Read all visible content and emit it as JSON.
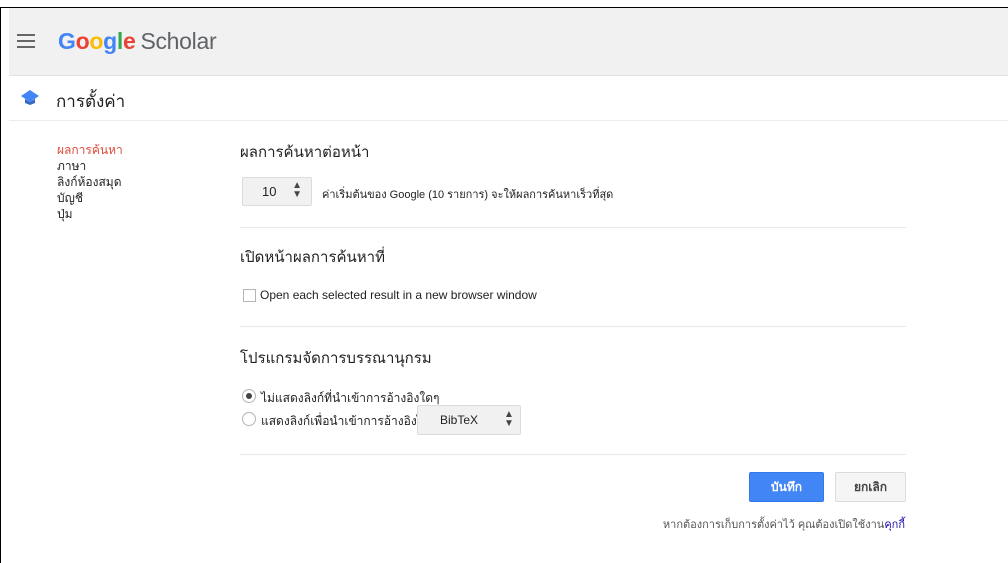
{
  "header": {
    "logo_g": "G",
    "logo_o1": "o",
    "logo_o2": "o",
    "logo_g2": "g",
    "logo_l": "l",
    "logo_e": "e",
    "logo_product": "Scholar"
  },
  "page": {
    "title": "การตั้งค่า"
  },
  "sidebar": {
    "items": [
      {
        "label": "ผลการค้นหา",
        "active": true
      },
      {
        "label": "ภาษา"
      },
      {
        "label": "ลิงก์ห้องสมุด"
      },
      {
        "label": "บัญชี"
      },
      {
        "label": "ปุ่ม"
      }
    ]
  },
  "results_per_page": {
    "title": "ผลการค้นหาต่อหน้า",
    "value": "10",
    "help": "ค่าเริ่มต้นของ Google (10 รายการ) จะให้ผลการค้นหาเร็วที่สุด"
  },
  "open_results": {
    "title": "เปิดหน้าผลการค้นหาที่",
    "checkbox_label": "Open each selected result in a new browser window",
    "checked": false
  },
  "bib_manager": {
    "title": "โปรแกรมจัดการบรรณานุกรม",
    "option_none": "ไม่แสดงลิงก์ที่นำเข้าการอ้างอิงใดๆ",
    "option_show": "แสดงลิงก์เพื่อนำเข้าการอ้างอิงไปที่",
    "format": "BibTeX",
    "selected": "none"
  },
  "actions": {
    "save": "บันทึก",
    "cancel": "ยกเลิก"
  },
  "footer": {
    "note": "หากต้องการเก็บการตั้งค่าไว้ คุณต้องเปิดใช้งาน",
    "link": "คุกกี้"
  },
  "colors": {
    "header_bg": "#f1f1f1",
    "primary": "#4285f4",
    "active_nav": "#dd4b39",
    "link": "#1a0dab"
  },
  "icons": {
    "menu": "hamburger-icon",
    "scholar_cap": "graduation-cap-icon"
  }
}
